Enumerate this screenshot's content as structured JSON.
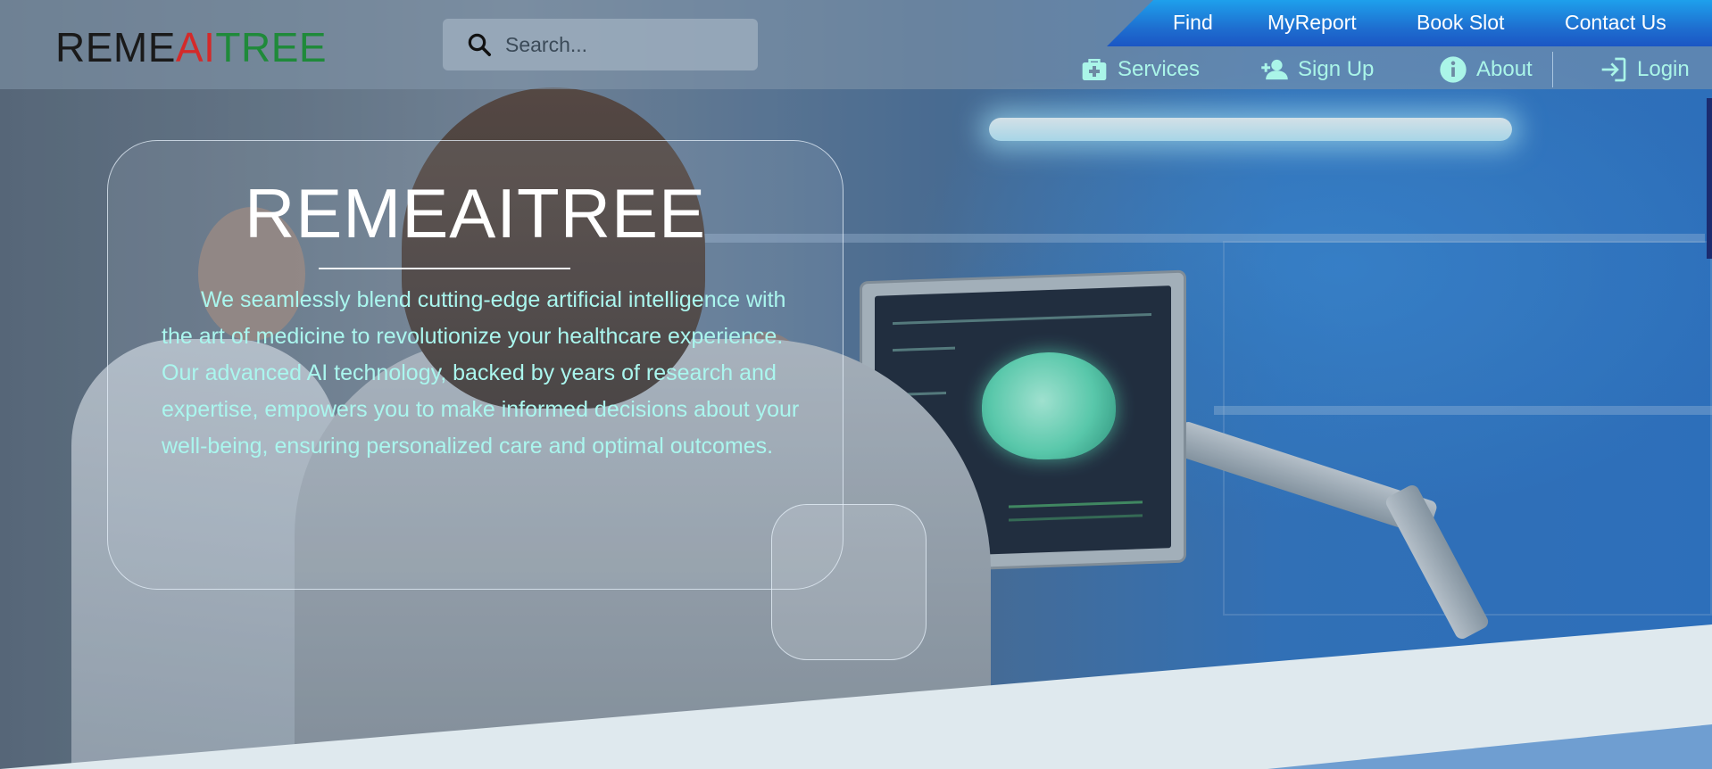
{
  "brand": {
    "logo_part1": "REME",
    "logo_part2": "AI",
    "logo_part3": "TREE",
    "colors": {
      "part1": "#1a1a1a",
      "part2": "#d42a2a",
      "part3": "#1f8a3a"
    }
  },
  "search": {
    "placeholder": "Search...",
    "icon": "search-icon"
  },
  "top_nav": {
    "items": [
      {
        "label": "Find"
      },
      {
        "label": "MyReport"
      },
      {
        "label": "Book Slot"
      },
      {
        "label": "Contact Us"
      }
    ]
  },
  "sub_nav": {
    "items": [
      {
        "label": "Services",
        "icon": "medical-kit-icon"
      },
      {
        "label": "Sign Up",
        "icon": "add-user-icon"
      },
      {
        "label": "About",
        "icon": "info-icon"
      },
      {
        "label": "Login",
        "icon": "login-icon"
      }
    ],
    "color": "#aaf5e8"
  },
  "hero": {
    "title": "REMEAITREE",
    "description": "We seamlessly blend cutting-edge artificial intelligence with the art of medicine to revolutionize your healthcare experience. Our advanced AI technology, backed by years of research and expertise, empowers you to make informed decisions about your well-being, ensuring personalized care and optimal outcomes."
  },
  "theme": {
    "accent": "#1e6fd0",
    "text_highlight": "#aaf6ee"
  }
}
